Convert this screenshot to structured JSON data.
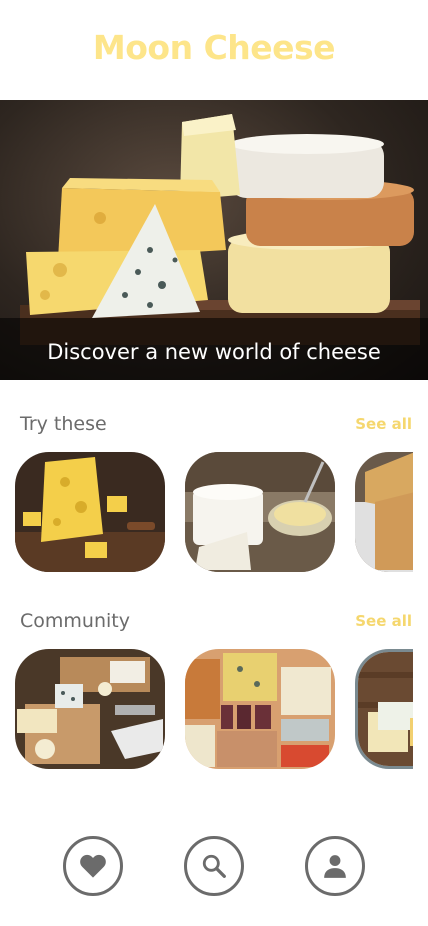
{
  "app": {
    "title": "Moon Cheese",
    "accent_color": "#fde58a",
    "link_color": "#f5d76e",
    "text_gray": "#6b6b6b"
  },
  "hero": {
    "caption": "Discover a new world of cheese"
  },
  "sections": [
    {
      "title": "Try these",
      "see_all_label": "See all"
    },
    {
      "title": "Community",
      "see_all_label": "See all"
    }
  ],
  "bottom_nav": {
    "items": [
      {
        "icon": "heart-icon"
      },
      {
        "icon": "search-icon"
      },
      {
        "icon": "person-icon"
      }
    ]
  }
}
